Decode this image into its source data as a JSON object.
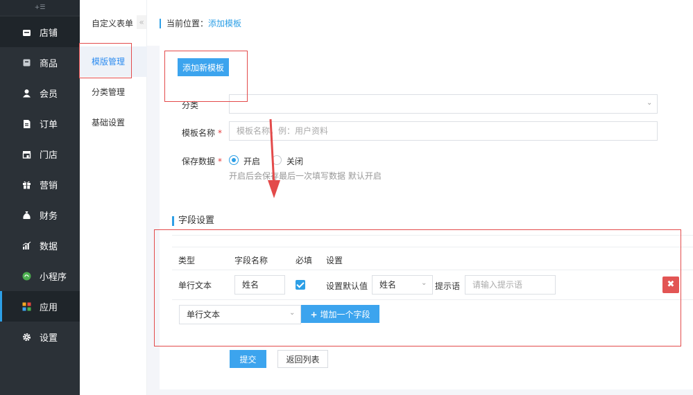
{
  "sidebar": {
    "toggle_icon": "menu-toggle-icon",
    "items": [
      {
        "label": "店铺",
        "icon": "store-icon"
      },
      {
        "label": "商品",
        "icon": "goods-icon"
      },
      {
        "label": "会员",
        "icon": "member-icon"
      },
      {
        "label": "订单",
        "icon": "order-icon"
      },
      {
        "label": "门店",
        "icon": "shop-front-icon"
      },
      {
        "label": "营销",
        "icon": "gift-icon"
      },
      {
        "label": "财务",
        "icon": "money-bag-icon"
      },
      {
        "label": "数据",
        "icon": "chart-icon"
      },
      {
        "label": "小程序",
        "icon": "mini-program-icon"
      },
      {
        "label": "应用",
        "icon": "apps-icon"
      },
      {
        "label": "设置",
        "icon": "gear-icon"
      }
    ],
    "active": "应用"
  },
  "subnav": {
    "items": [
      {
        "label": "自定义表单"
      },
      {
        "label": "模版管理"
      },
      {
        "label": "分类管理"
      },
      {
        "label": "基础设置"
      }
    ],
    "active": "模版管理"
  },
  "breadcrumb": {
    "prefix": "当前位置：",
    "current": "添加模板"
  },
  "form": {
    "add_button": "添加新模板",
    "category_label": "分类",
    "category_value": "",
    "name_label": "模板名称",
    "name_placeholder": "模板名称，例：用户资料",
    "save_label": "保存数据",
    "save_on": "开启",
    "save_off": "关闭",
    "save_hint": "开启后会保存最后一次填写数据 默认开启",
    "required_mark": "*"
  },
  "fields": {
    "section_title": "字段设置",
    "headers": [
      "类型",
      "字段名称",
      "必填",
      "设置"
    ],
    "rows": [
      {
        "type": "单行文本",
        "name": "姓名",
        "required": true,
        "default_label": "设置默认值",
        "default_value": "姓名",
        "hint_label": "提示语",
        "hint_placeholder": "请输入提示语"
      }
    ],
    "new_type": "单行文本",
    "add_field_button": "增加一个字段",
    "delete_icon": "✖"
  },
  "actions": {
    "submit": "提交",
    "back": "返回列表"
  },
  "colors": {
    "accent": "#2d9fe6",
    "sidebar_bg": "#2b3137",
    "danger": "#e25554",
    "annotation": "#e34a4a"
  }
}
